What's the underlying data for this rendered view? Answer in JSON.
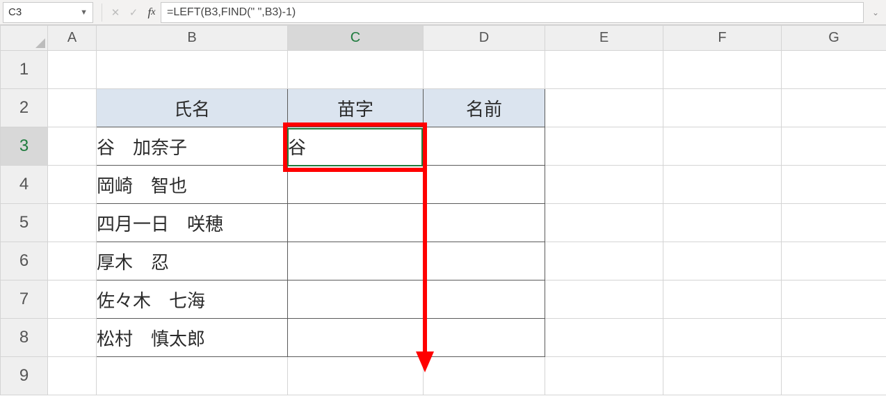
{
  "formula_bar": {
    "cell_reference": "C3",
    "formula": "=LEFT(B3,FIND(\"  \",B3)-1)"
  },
  "column_headers": [
    "A",
    "B",
    "C",
    "D",
    "E",
    "F",
    "G"
  ],
  "row_headers": [
    "1",
    "2",
    "3",
    "4",
    "5",
    "6",
    "7",
    "8",
    "9"
  ],
  "active_cell": "C3",
  "sheet_table": {
    "header": {
      "b2": "氏名",
      "c2": "苗字",
      "d2": "名前"
    },
    "rows": {
      "b3": "谷　加奈子",
      "c3": "谷",
      "b4": "岡崎　智也",
      "b5": "四月一日　咲穂",
      "b6": "厚木　忍",
      "b7": "佐々木　七海",
      "b8": "松村　慎太郎"
    }
  },
  "chart_data": {
    "type": "table",
    "title": "",
    "columns": [
      "氏名",
      "苗字",
      "名前"
    ],
    "rows": [
      [
        "谷　加奈子",
        "谷",
        ""
      ],
      [
        "岡崎　智也",
        "",
        ""
      ],
      [
        "四月一日　咲穂",
        "",
        ""
      ],
      [
        "厚木　忍",
        "",
        ""
      ],
      [
        "佐々木　七海",
        "",
        ""
      ],
      [
        "松村　慎太郎",
        "",
        ""
      ]
    ]
  }
}
